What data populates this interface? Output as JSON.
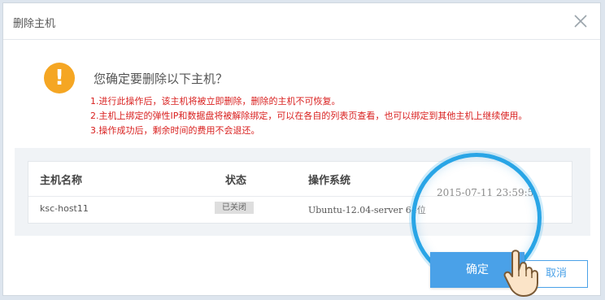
{
  "dialog": {
    "title": "删除主机",
    "question": "您确定要删除以下主机？",
    "warnings": [
      "1.进行此操作后，该主机将被立即删除，删除的主机不可恢复。",
      "2.主机上绑定的弹性IP和数据盘将被解除绑定，可以在各自的列表页查看，也可以绑定到其他主机上继续使用。",
      "3.操作成功后，剩余时间的费用不会退还。"
    ]
  },
  "table": {
    "headers": {
      "name": "主机名称",
      "status": "状态",
      "os": "操作系统"
    },
    "rows": [
      {
        "name": "ksc-host11",
        "status": "已关闭",
        "os": "Ubuntu-12.04-server 64位"
      }
    ]
  },
  "datetime": "2015-07-11 23:59:5",
  "buttons": {
    "ok": "确定",
    "cancel": "取消"
  },
  "colors": {
    "accent": "#4aa1e8",
    "warning": "#d9201f",
    "icon": "#f5a623"
  },
  "icons": {
    "warn": "exclamation-icon",
    "close": "close-icon",
    "pointer": "hand-pointer-icon"
  }
}
